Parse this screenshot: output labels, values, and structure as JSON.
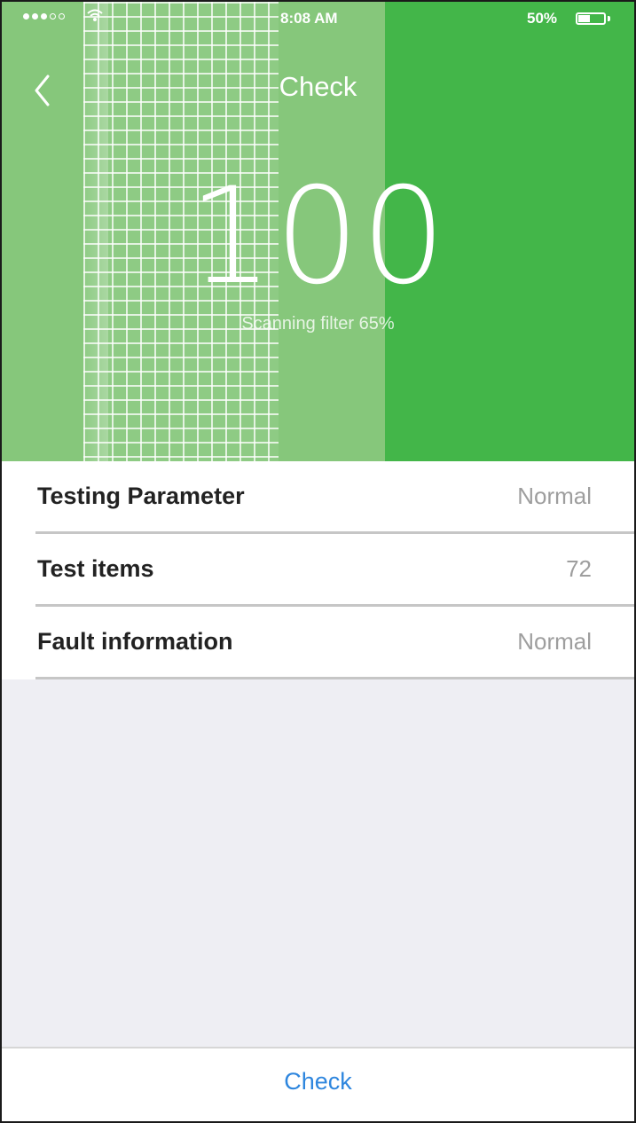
{
  "status_bar": {
    "time": "8:08 AM",
    "battery_percent": "50%",
    "signal_bars_filled": 3,
    "signal_bars_total": 5,
    "battery_level": 0.5
  },
  "nav": {
    "title": "Check",
    "back_icon": "chevron-left-icon"
  },
  "hero": {
    "score": "100",
    "scan_status": "Scanning filter 65%",
    "color_primary": "#43b649",
    "color_scan_band": "#86c77b"
  },
  "list": {
    "rows": [
      {
        "label": "Testing Parameter",
        "value": "Normal"
      },
      {
        "label": "Test items",
        "value": "72"
      },
      {
        "label": "Fault information",
        "value": "Normal"
      }
    ]
  },
  "bottom": {
    "button_label": "Check",
    "button_color": "#2e86de"
  }
}
